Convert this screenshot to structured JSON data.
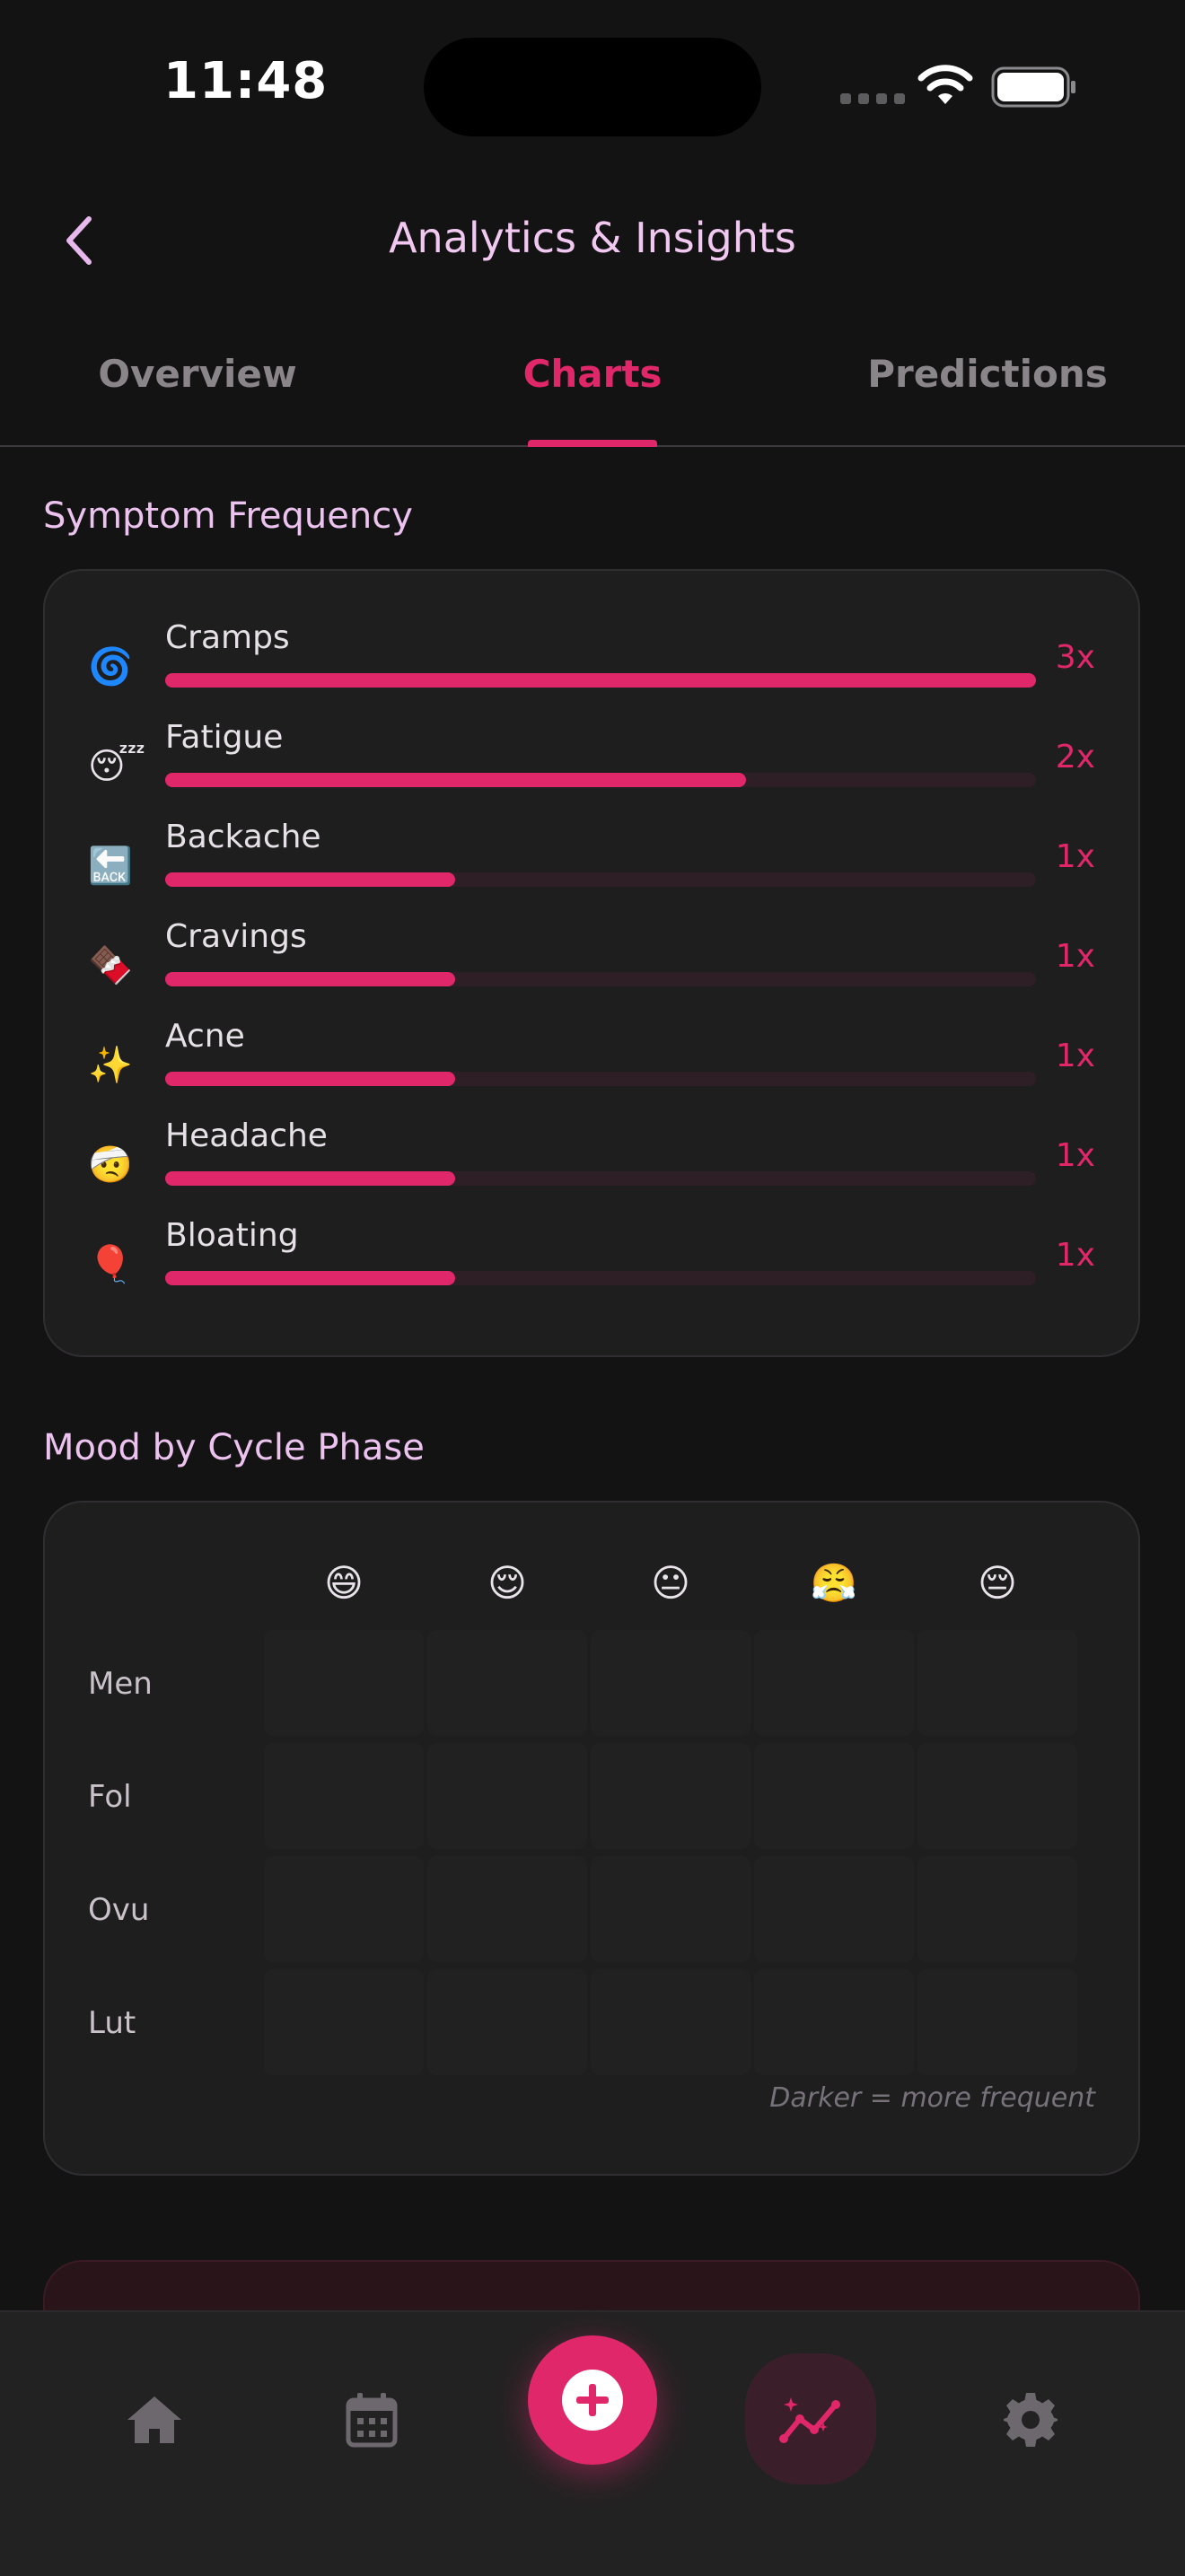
{
  "status_bar": {
    "time": "11:48"
  },
  "header": {
    "title": "Analytics & Insights",
    "back_icon": "chevron-left-icon"
  },
  "tabs": [
    {
      "label": "Overview",
      "active": false
    },
    {
      "label": "Charts",
      "active": true
    },
    {
      "label": "Predictions",
      "active": false
    }
  ],
  "symptoms": {
    "title": "Symptom Frequency",
    "items": [
      {
        "icon": "🌀",
        "label": "Cramps",
        "count_label": "3x",
        "count": 3,
        "max": 3
      },
      {
        "icon": "😴",
        "label": "Fatigue",
        "count_label": "2x",
        "count": 2,
        "max": 3
      },
      {
        "icon": "🔙",
        "label": "Backache",
        "count_label": "1x",
        "count": 1,
        "max": 3
      },
      {
        "icon": "🍫",
        "label": "Cravings",
        "count_label": "1x",
        "count": 1,
        "max": 3
      },
      {
        "icon": "✨",
        "label": "Acne",
        "count_label": "1x",
        "count": 1,
        "max": 3
      },
      {
        "icon": "🤕",
        "label": "Headache",
        "count_label": "1x",
        "count": 1,
        "max": 3
      },
      {
        "icon": "🎈",
        "label": "Bloating",
        "count_label": "1x",
        "count": 1,
        "max": 3
      }
    ]
  },
  "mood": {
    "title": "Mood by Cycle Phase",
    "emojis": [
      "😄",
      "😌",
      "😐",
      "😤",
      "😔"
    ],
    "phases": [
      "Men",
      "Fol",
      "Ovu",
      "Lut"
    ],
    "note": "Darker = more frequent"
  },
  "colors": {
    "accent": "#e0276a",
    "title": "#f0c8f0",
    "background": "#141314",
    "card": "#1f1e1f"
  },
  "bottom_nav": [
    {
      "icon": "home-icon"
    },
    {
      "icon": "calendar-icon"
    },
    {
      "icon": "plus-icon"
    },
    {
      "icon": "analytics-icon"
    },
    {
      "icon": "gear-icon"
    }
  ]
}
